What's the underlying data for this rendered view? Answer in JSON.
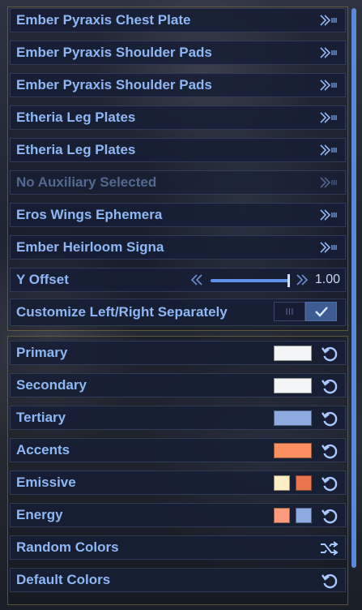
{
  "equipment": [
    {
      "label": "Ember Pyraxis Chest Plate",
      "icon": "chevron-forward-icon",
      "enabled": true
    },
    {
      "label": "Ember Pyraxis Shoulder Pads",
      "icon": "chevron-forward-icon",
      "enabled": true
    },
    {
      "label": "Ember Pyraxis Shoulder Pads",
      "icon": "chevron-forward-icon",
      "enabled": true
    },
    {
      "label": "Etheria Leg Plates",
      "icon": "chevron-forward-icon",
      "enabled": true
    },
    {
      "label": "Etheria Leg Plates",
      "icon": "chevron-forward-icon",
      "enabled": true
    },
    {
      "label": "No Auxiliary Selected",
      "icon": "chevron-forward-icon",
      "enabled": false
    },
    {
      "label": "Eros Wings Ephemera",
      "icon": "chevron-forward-icon",
      "enabled": true
    },
    {
      "label": "Ember Heirloom Signa",
      "icon": "chevron-forward-icon",
      "enabled": true
    }
  ],
  "y_offset": {
    "label": "Y Offset",
    "value_text": "1.00",
    "fill_fraction": 1.0
  },
  "customize": {
    "label": "Customize Left/Right Separately",
    "checked": true
  },
  "colors": [
    {
      "label": "Primary",
      "swatches": [
        "#f4f5f7"
      ]
    },
    {
      "label": "Secondary",
      "swatches": [
        "#f4f5f7"
      ]
    },
    {
      "label": "Tertiary",
      "swatches": [
        "#8eaae0"
      ]
    },
    {
      "label": "Accents",
      "swatches": [
        "#fb8f62"
      ]
    },
    {
      "label": "Emissive",
      "swatches": [
        "#fdefc3",
        "#e9754e"
      ]
    },
    {
      "label": "Energy",
      "swatches": [
        "#fb9b7b",
        "#8eaae0"
      ]
    }
  ],
  "random_colors": {
    "label": "Random Colors",
    "icon": "shuffle-icon"
  },
  "default_colors": {
    "label": "Default Colors",
    "icon": "reset-icon"
  },
  "theme": {
    "accent": "#8fb7f5",
    "disabled_text": "#53698f",
    "icon_color": "#a9c8ff"
  }
}
